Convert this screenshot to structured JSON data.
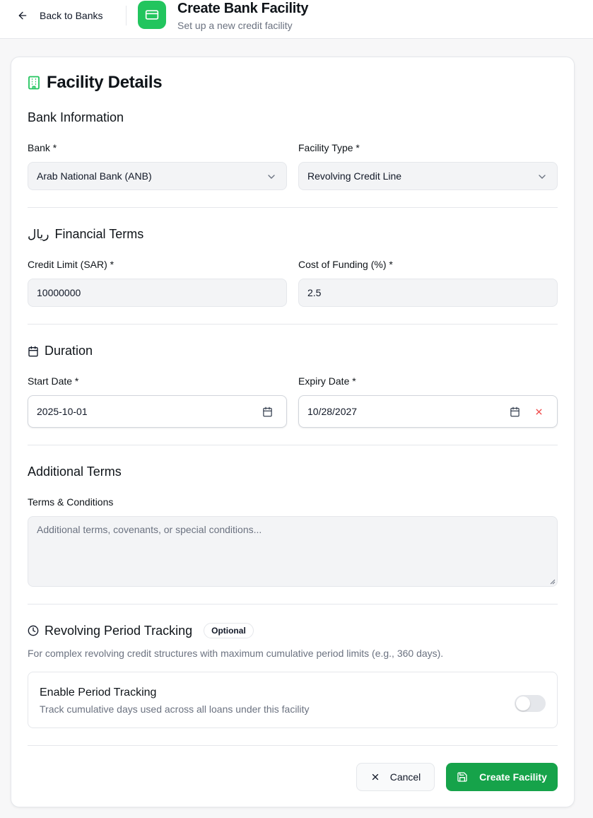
{
  "header": {
    "back_label": "Back to Banks",
    "title": "Create Bank Facility",
    "subtitle": "Set up a new credit facility"
  },
  "card": {
    "title": "Facility Details"
  },
  "bank_info": {
    "title": "Bank Information",
    "bank_label": "Bank *",
    "bank_value": "Arab National Bank (ANB)",
    "type_label": "Facility Type *",
    "type_value": "Revolving Credit Line"
  },
  "financial": {
    "title": "Financial Terms",
    "currency_symbol": "ريال",
    "credit_label": "Credit Limit (SAR) *",
    "credit_value": "10000000",
    "cof_label": "Cost of Funding (%) *",
    "cof_value": "2.5"
  },
  "duration": {
    "title": "Duration",
    "start_label": "Start Date *",
    "start_value": "2025-10-01",
    "expiry_label": "Expiry Date *",
    "expiry_value": "10/28/2027"
  },
  "additional": {
    "title": "Additional Terms",
    "terms_label": "Terms & Conditions",
    "terms_placeholder": "Additional terms, covenants, or special conditions..."
  },
  "revolving": {
    "title": "Revolving Period Tracking",
    "badge": "Optional",
    "description": "For complex revolving credit structures with maximum cumulative period limits (e.g., 360 days).",
    "toggle_title": "Enable Period Tracking",
    "toggle_desc": "Track cumulative days used across all loans under this facility",
    "enabled": false
  },
  "actions": {
    "cancel": "Cancel",
    "create": "Create Facility"
  },
  "colors": {
    "accent": "#22c55e",
    "primary_button": "#16a34a",
    "clear_icon": "#ef4444"
  }
}
